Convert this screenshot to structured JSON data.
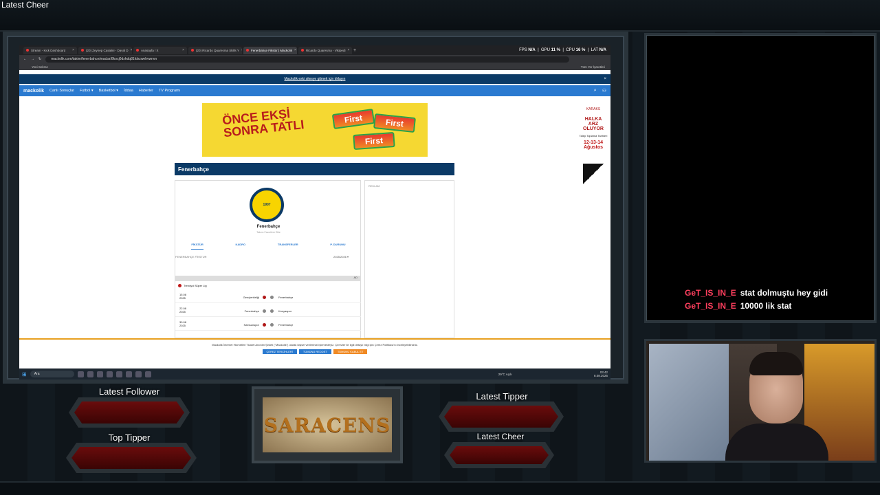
{
  "overlay": {
    "latest_cheer_top": "Latest Cheer",
    "widgets": {
      "latest_follower": "Latest Follower",
      "top_tipper": "Top Tipper",
      "latest_tipper": "Latest Tipper",
      "latest_cheer": "Latest Cheer"
    },
    "logo_text": "SARACENS"
  },
  "chat": [
    {
      "user": "GeT_IS_IN_E",
      "message": "stat dolmuştu hey gidi"
    },
    {
      "user": "GeT_IS_IN_E",
      "message": "10000 lik stat"
    }
  ],
  "browser": {
    "tabs": [
      {
        "label": "Stream - Kick Dashboard"
      },
      {
        "label": "(20) Zeynep Casalini - Daval D"
      },
      {
        "label": "Anasayfa / X"
      },
      {
        "label": "(20) Ricardo Quaresma Skills Y"
      },
      {
        "label": "Fenerbahçe Fikstür | Mackolik",
        "active": true
      },
      {
        "label": "Ricardo Quaresma - Vikipedi"
      }
    ],
    "perf": {
      "fps_label": "FPS",
      "fps": "N/A",
      "gpu_label": "GPU",
      "gpu": "11 %",
      "cpu_label": "CPU",
      "cpu": "16 %",
      "lat_label": "LAT",
      "lat": "N/A"
    },
    "url": "mackolik.com/takim/fenerbahce/maclar/8kocj0dxhdq81fdxzwehvwnvn",
    "bookmark": "Yeni Sekme",
    "bookmark_right": "Tüm Yer İşaretleri"
  },
  "site": {
    "notice": "Mackolik eski sitesye gitmek için tıklayın",
    "logo": "mackolik",
    "nav": [
      "Canlı Sonuçlar",
      "Futbol ▾",
      "Basketbol ▾",
      "İddaa",
      "Haberler",
      "TV Programı"
    ],
    "ad_text": "ÖNCE EKŞİ SONRA TATLI",
    "ad_brand": "First",
    "side_ad": {
      "brand": "KARAKS",
      "line1": "HALKA",
      "line2": "ARZ",
      "line3": "OLUYOR",
      "sub": "Talep Toplama Tarihleri",
      "dates": "12-13-14",
      "month": "Ağustos"
    },
    "team_title": "Fenerbahçe",
    "team_name": "Fenerbahçe",
    "team_sub": "Takımı Favorilere Ekle",
    "crest_text": "1907",
    "tabs": [
      "FİKSTÜR",
      "KADRO",
      "TRANSFERLER",
      "P. DURUMU"
    ],
    "fixture_title": "FENERBAHÇE FİKSTÜR",
    "season": "2025/2026 ▾",
    "sidebar_label": "REKLAM",
    "ad_row": "AD",
    "league": "Trendyol Süper Lig",
    "matches": [
      {
        "date": "15.08",
        "year": "2025",
        "home": "Gençlerbirliği",
        "away": "Fenerbahçe"
      },
      {
        "date": "22.08",
        "year": "2025",
        "home": "Fenerbahçe",
        "away": "Konyaspor"
      },
      {
        "date": "30.08",
        "year": "2025",
        "home": "Samsunspor",
        "away": "Fenerbahçe"
      }
    ],
    "cookie_text": "Mackolik İnternet Hizmetleri Ticaret Anonim Şirketi (\"Mackolik\") olarak kişisel verilerinizi işlemekteyiz. Çerezler ile ilgili detaylı bilgi için Çerez Politikası'nı inceleyebilirsiniz.",
    "cookie_buttons": [
      "ÇEREZ TERCİHLERİ",
      "TÜMÜNÜ REDDET",
      "TÜMÜNÜ KABUL ET"
    ]
  },
  "taskbar": {
    "search": "Ara",
    "weather": "29°C Açık",
    "time": "03:42",
    "date": "8.08.2025"
  }
}
